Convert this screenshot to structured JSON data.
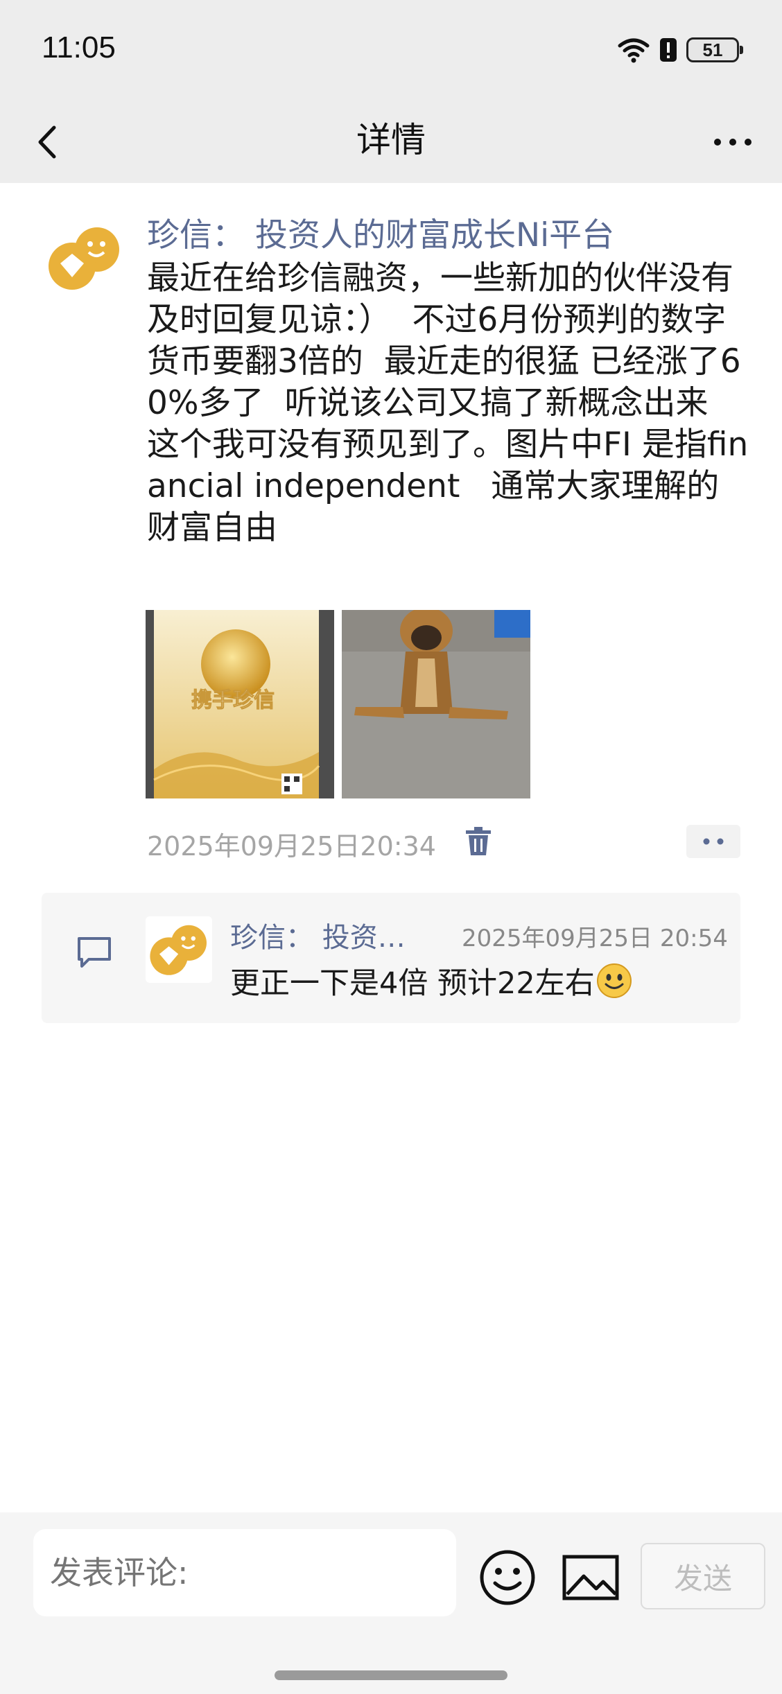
{
  "status_bar": {
    "time": "11:05",
    "battery": "51"
  },
  "nav": {
    "title": "详情"
  },
  "post": {
    "author": "珍信： 投资人的财富成长Ni平台",
    "text": "最近在给珍信融资，一些新加的伙伴没有及时回复见谅：）  不过6月份预判的数字货币要翻3倍的  最近走的很猛 已经涨了60%多了  听说该公司又搞了新概念出来  这个我可没有预见到了。图片中FI 是指financial independent   通常大家理解的财富自由",
    "images": [
      {
        "icon": "promo-poster-image",
        "caption": "携手珍信"
      },
      {
        "icon": "dog-photo-image"
      }
    ],
    "timestamp": "2025年09月25日20:34"
  },
  "comment": {
    "author": "珍信： 投资…",
    "timestamp": "2025年09月25日 20:54",
    "text": "更正一下是4倍  预计22左右"
  },
  "composer": {
    "placeholder": "发表评论:",
    "send_label": "发送"
  },
  "colors": {
    "name_blue": "#5b6b93",
    "avatar_gold": "#e9b13a"
  }
}
